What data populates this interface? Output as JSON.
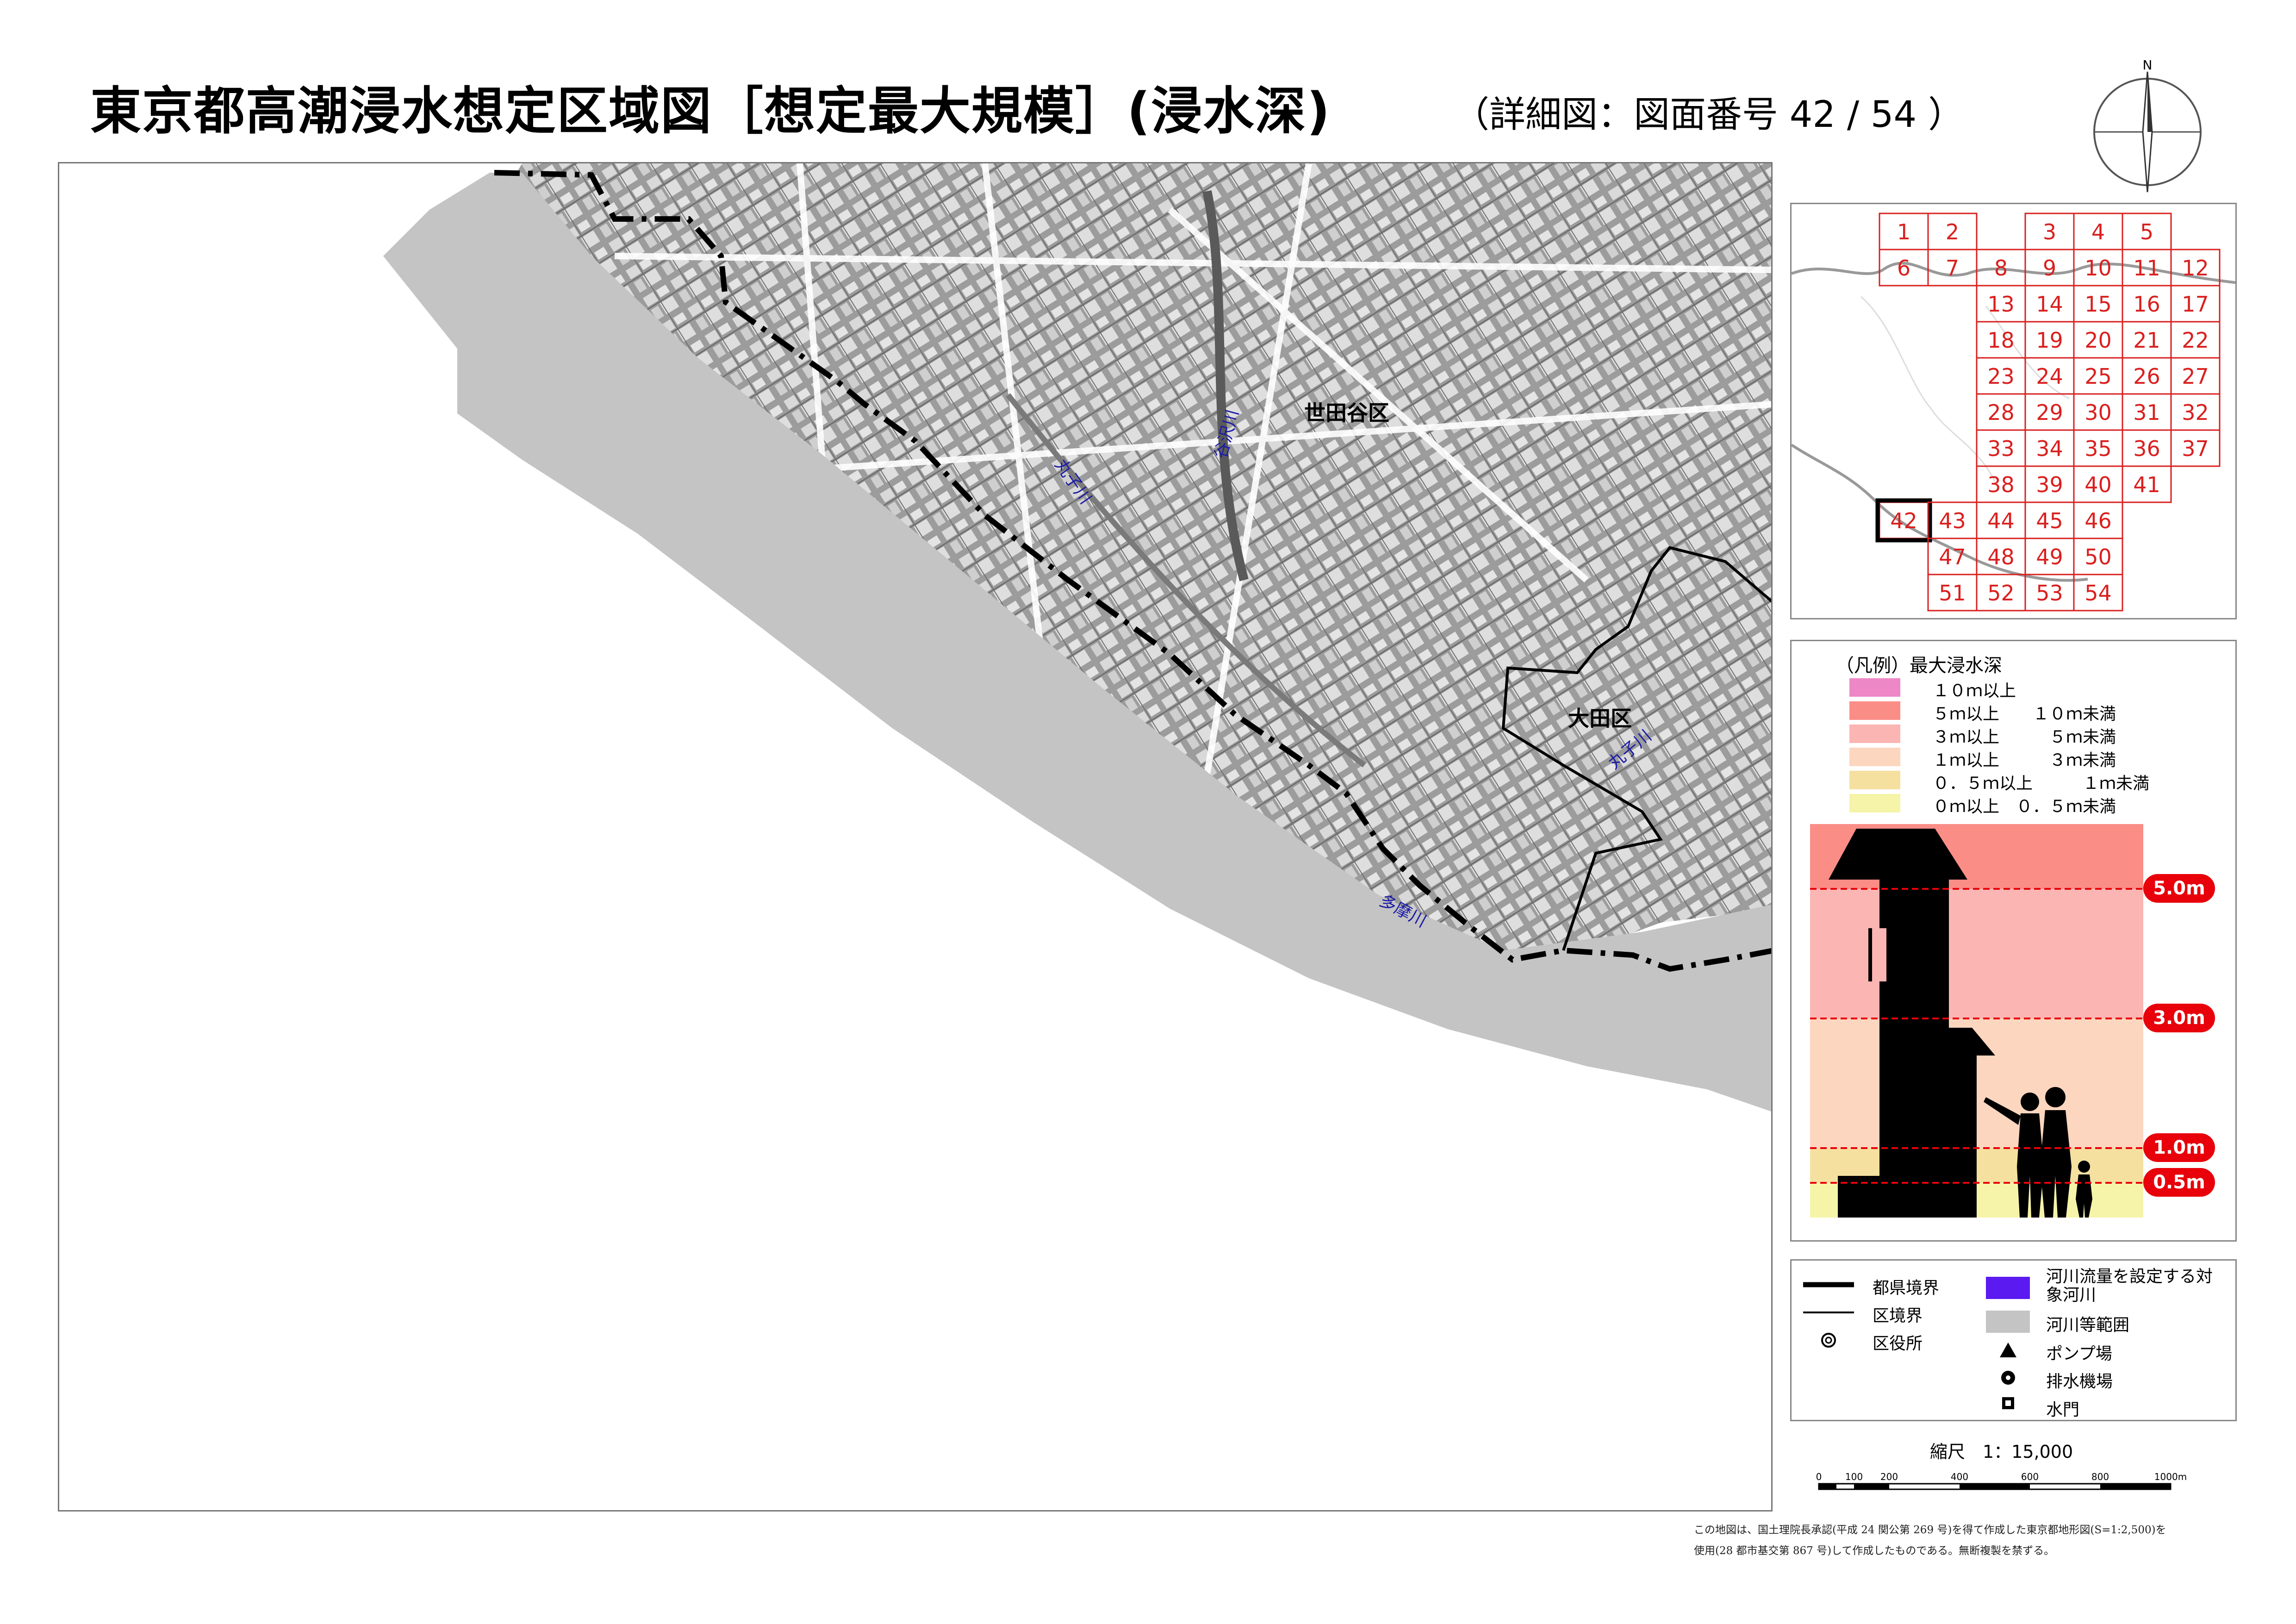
{
  "header": {
    "title": "東京都高潮浸水想定区域図［想定最大規模］(浸水深)",
    "subtitle": "（詳細図：図面番号 42 / 54 ）"
  },
  "north_arrow": {
    "label": "N",
    "icon": "north-arrow-icon"
  },
  "map": {
    "ward_labels": [
      "世田谷区",
      "大田区"
    ],
    "river_labels": [
      "谷沢川",
      "丸子川",
      "丸子川",
      "多摩川"
    ],
    "colors": {
      "river_area": "#c4c4c4",
      "urban_base": "#8f8f8f",
      "pref_boundary": "#000000"
    }
  },
  "index_map": {
    "sheets": [
      "1",
      "2",
      "3",
      "4",
      "5",
      "6",
      "7",
      "8",
      "9",
      "10",
      "11",
      "12",
      "13",
      "14",
      "15",
      "16",
      "17",
      "18",
      "19",
      "20",
      "21",
      "22",
      "23",
      "24",
      "25",
      "26",
      "27",
      "28",
      "29",
      "30",
      "31",
      "32",
      "33",
      "34",
      "35",
      "36",
      "37",
      "38",
      "39",
      "40",
      "41",
      "42",
      "43",
      "44",
      "45",
      "46",
      "47",
      "48",
      "49",
      "50",
      "51",
      "52",
      "53",
      "54"
    ],
    "current_sheet": "42",
    "grid_color": "#d9201f"
  },
  "legend_depth": {
    "title": "（凡例）最大浸水深",
    "classes": [
      {
        "label": "１０ｍ以上",
        "color": "#ee87c6"
      },
      {
        "label": "５ｍ以上　　１０ｍ未満",
        "color": "#fb8d87"
      },
      {
        "label": "３ｍ以上　　　５ｍ未満",
        "color": "#fbb5b3"
      },
      {
        "label": "１ｍ以上　　　３ｍ未満",
        "color": "#fcd6bf"
      },
      {
        "label": "０．５ｍ以上　　　１ｍ未満",
        "color": "#f5e0a0"
      },
      {
        "label": "０ｍ以上　０．５ｍ未満",
        "color": "#f6f4a8"
      }
    ],
    "depth_markers": [
      "5.0m",
      "3.0m",
      "1.0m",
      "0.5m"
    ]
  },
  "legend_symbols": {
    "pref_boundary": "都県境界",
    "ward_boundary": "区境界",
    "ward_office": "区役所",
    "target_river": "河川流量を設定する対象河川",
    "river_area": "河川等範囲",
    "pump_station": "ポンプ場",
    "drainage_station": "排水機場",
    "sluice_gate": "水門",
    "target_river_color": "#5b1aef",
    "river_area_color": "#c4c4c4"
  },
  "scale": {
    "label": "縮尺　1：15,000",
    "ticks": [
      "0",
      "100",
      "200",
      "400",
      "600",
      "800",
      "1000m"
    ]
  },
  "credit": {
    "line1": "この地図は、国土理院長承認(平成 24 関公第 269 号)を得て作成した東京都地形図(S=1:2,500)を",
    "line2": "使用(28 都市基交第 867 号)して作成したものである。無断複製を禁ずる。"
  }
}
